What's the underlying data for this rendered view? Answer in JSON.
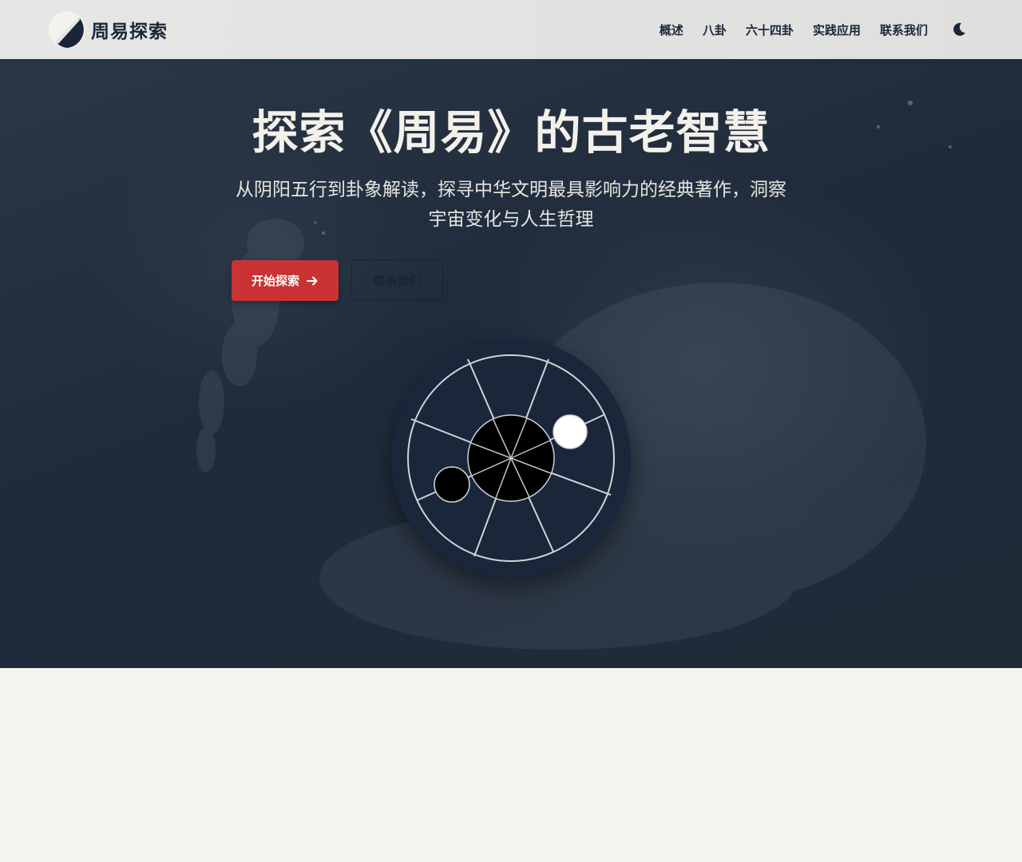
{
  "brand": {
    "name": "周易探索",
    "logo_icon": "yin-yang-logo-icon"
  },
  "nav": {
    "items": [
      {
        "label": "概述"
      },
      {
        "label": "八卦"
      },
      {
        "label": "六十四卦"
      },
      {
        "label": "实践应用"
      },
      {
        "label": "联系我们"
      }
    ],
    "theme_toggle_icon": "moon-icon"
  },
  "hero": {
    "title": "探索《周易》的古老智慧",
    "subtitle": "从阴阳五行到卦象解读，探寻中华文明最具影响力的经典著作，洞察宇宙变化与人生哲理",
    "primary_button": {
      "label": "开始探索",
      "icon": "arrow-right-icon"
    },
    "secondary_button": {
      "label": "联系我们"
    },
    "graphic_icon": "bagua-wheel-icon"
  },
  "colors": {
    "navbar_bg": "#e3e4e1",
    "hero_bg": "#1f2b3b",
    "accent_red": "#c93333",
    "text_dark": "#1a2638",
    "page_bg": "#f4f4ef"
  }
}
